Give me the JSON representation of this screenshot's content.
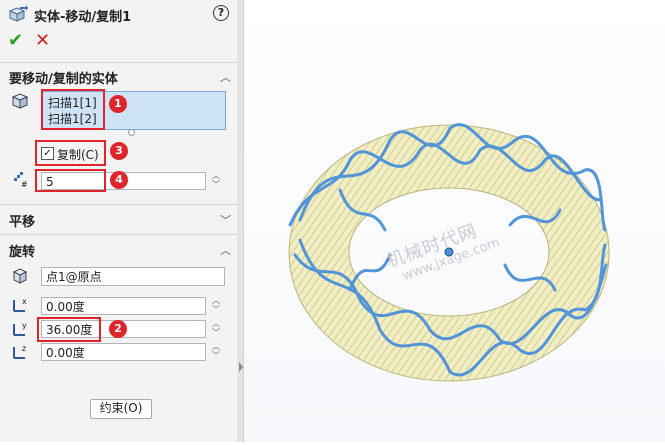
{
  "header": {
    "title": "实体-移动/复制1",
    "help_icon": "?",
    "ok_icon": "✔",
    "cancel_icon": "✕"
  },
  "bodies_section": {
    "title": "要移动/复制的实体",
    "items": [
      "扫描1[1]",
      "扫描1[2]"
    ],
    "copy_checked": true,
    "copy_label": "复制(C)",
    "copy_count": "5"
  },
  "translate_section": {
    "title": "平移"
  },
  "rotate_section": {
    "title": "旋转",
    "origin_value": "点1@原点",
    "x_angle": "0.00度",
    "y_angle": "36.00度",
    "z_angle": "0.00度",
    "constraints_button": "约束(O)"
  },
  "annotations": [
    "1",
    "2",
    "3",
    "4"
  ],
  "watermark": {
    "line1": "机械时代网",
    "line2": "www.jxage.com"
  },
  "colors": {
    "accent": "#e0242b",
    "list_bg": "#cfe3f7",
    "torus_yellow": "#e9e5a6",
    "helix_blue": "#4a90d9"
  }
}
